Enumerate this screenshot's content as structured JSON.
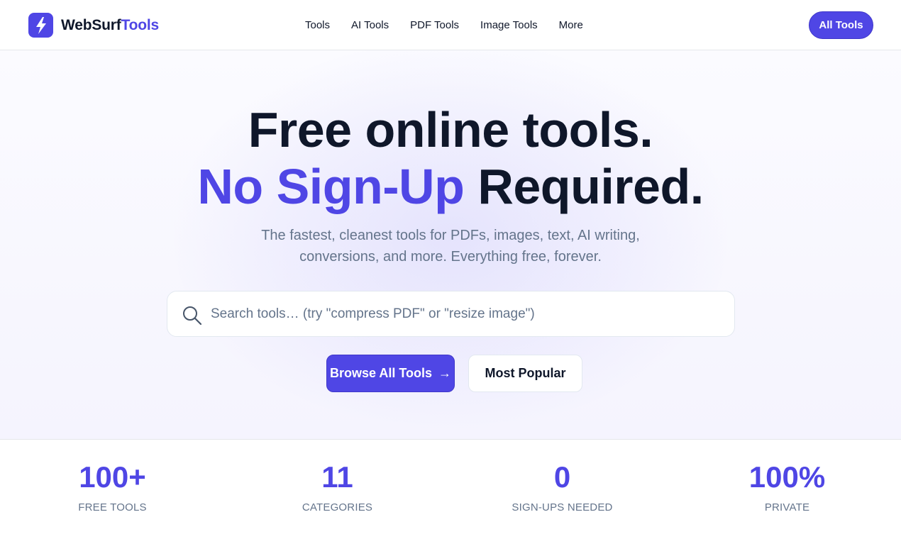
{
  "brand": {
    "name_part1": "WebSurf",
    "name_part2": "Tools",
    "accent": "#4f46e5"
  },
  "nav": {
    "items": [
      {
        "label": "Tools"
      },
      {
        "label": "AI Tools"
      },
      {
        "label": "PDF Tools"
      },
      {
        "label": "Image Tools"
      },
      {
        "label": "More"
      }
    ],
    "cta_label": "All Tools"
  },
  "hero": {
    "title_line1": "Free online tools.",
    "title_accent": "No Sign-Up",
    "title_rest": " Required.",
    "subtitle": "The fastest, cleanest tools for PDFs, images, text, AI writing, conversions, and more. Everything free, forever.",
    "search": {
      "placeholder": "Search tools… (try \"compress PDF\" or \"resize image\")",
      "value": "",
      "icon": "search-icon"
    },
    "primary_button": {
      "label": "Browse All Tools",
      "arrow": "→"
    },
    "secondary_button": {
      "label": "Most Popular"
    }
  },
  "stats": [
    {
      "value": "100+",
      "label": "FREE TOOLS"
    },
    {
      "value": "11",
      "label": "CATEGORIES"
    },
    {
      "value": "0",
      "label": "SIGN-UPS NEEDED"
    },
    {
      "value": "100%",
      "label": "PRIVATE"
    }
  ]
}
